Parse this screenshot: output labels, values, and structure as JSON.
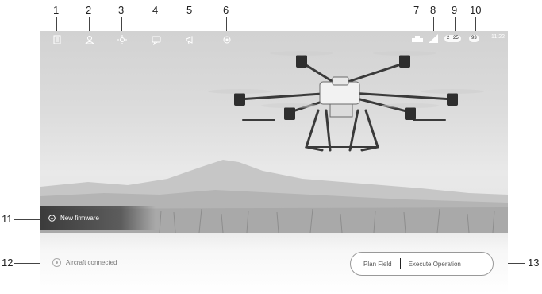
{
  "callouts": [
    "1",
    "2",
    "3",
    "4",
    "5",
    "6",
    "7",
    "8",
    "9",
    "10",
    "11",
    "12",
    "13"
  ],
  "toolbar": {
    "icons": [
      "document-icon",
      "user-icon",
      "sun-icon",
      "chat-icon",
      "megaphone-icon",
      "settings-icon"
    ]
  },
  "status": {
    "battery_remote": "2",
    "battery_remote_pct": "25",
    "battery_aircraft_pct": "93",
    "time": "11:22"
  },
  "firmware": {
    "label": "New firmware"
  },
  "connection": {
    "label": "Aircraft connected"
  },
  "operations": {
    "plan": "Plan Field",
    "execute": "Execute Operation"
  },
  "colors": {
    "status_bar_text": "#ffffff",
    "panel_border": "#999999"
  }
}
